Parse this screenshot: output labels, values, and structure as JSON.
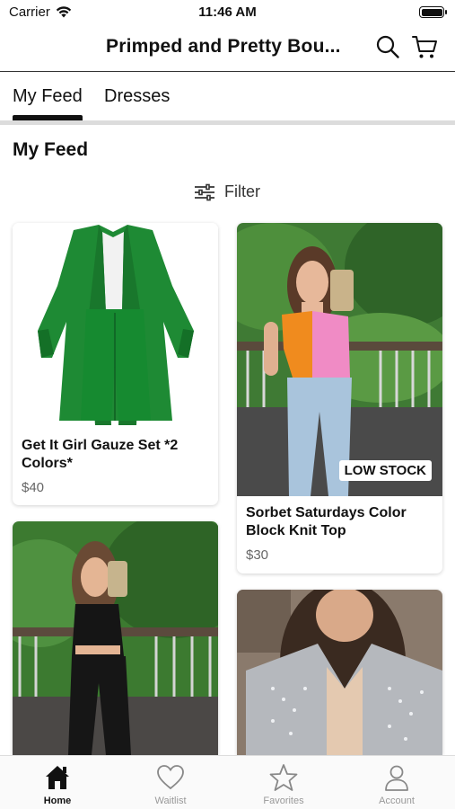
{
  "status": {
    "carrier": "Carrier",
    "time": "11:46 AM"
  },
  "nav": {
    "title": "Primped and Pretty Bou..."
  },
  "tabs": [
    {
      "label": "My Feed"
    },
    {
      "label": "Dresses"
    }
  ],
  "section": {
    "title": "My Feed"
  },
  "filter": {
    "label": "Filter"
  },
  "products": [
    {
      "name": "Get It Girl Gauze Set *2 Colors*",
      "price": "$40"
    },
    {
      "name": "Sorbet Saturdays Color Block Knit Top",
      "price": "$30",
      "badge": "LOW STOCK"
    }
  ],
  "tabbar": [
    {
      "label": "Home",
      "icon": "home-icon"
    },
    {
      "label": "Waitlist",
      "icon": "heart-icon"
    },
    {
      "label": "Favorites",
      "icon": "star-icon"
    },
    {
      "label": "Account",
      "icon": "person-icon"
    }
  ],
  "colors": {
    "accent": "#111111",
    "divider": "#dcdcdc",
    "muted": "#999999"
  }
}
